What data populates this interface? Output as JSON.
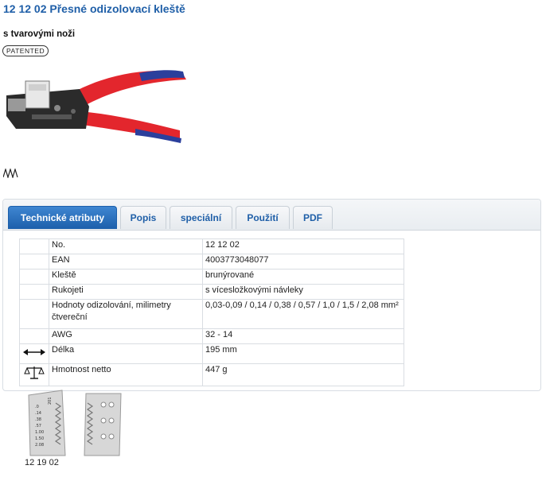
{
  "product": {
    "title": "12 12 02 Přesné odizolovací kleště",
    "subtitle": "s tvarovými noži",
    "badge": "PATENTED"
  },
  "tabs": [
    {
      "label": "Technické atributy",
      "active": true
    },
    {
      "label": "Popis",
      "active": false
    },
    {
      "label": "speciální",
      "active": false
    },
    {
      "label": "Použití",
      "active": false
    },
    {
      "label": "PDF",
      "active": false
    }
  ],
  "attributes": [
    {
      "label": "No.",
      "value": "12 12 02",
      "icon": ""
    },
    {
      "label": "EAN",
      "value": "4003773048077",
      "icon": ""
    },
    {
      "label": "Kleště",
      "value": "brunýrované",
      "icon": ""
    },
    {
      "label": "Rukojeti",
      "value": "s vícesložkovými návleky",
      "icon": ""
    },
    {
      "label": "Hodnoty odizolování, milimetry čtvereční",
      "value": "0,03-0,09 / 0,14 / 0,38 / 0,57 / 1,0 / 1,5 / 2,08 mm²",
      "icon": ""
    },
    {
      "label": "AWG",
      "value": "32 - 14",
      "icon": ""
    },
    {
      "label": "Délka",
      "value": "195 mm",
      "icon": "length-arrow-icon"
    },
    {
      "label": "Hmotnost netto",
      "value": "447 g",
      "icon": "scale-icon"
    }
  ],
  "accessory": {
    "caption": "12 19 02",
    "blade_labels": [
      ".0",
      ".14",
      ".38",
      ".57",
      "1.00",
      "1.50",
      "2.08"
    ],
    "blade_number": "201"
  },
  "colors": {
    "accent": "#1f5fa8",
    "tab_active": "#2a6fbe",
    "handle_red": "#e3262d",
    "handle_blue": "#2b3f9c"
  }
}
